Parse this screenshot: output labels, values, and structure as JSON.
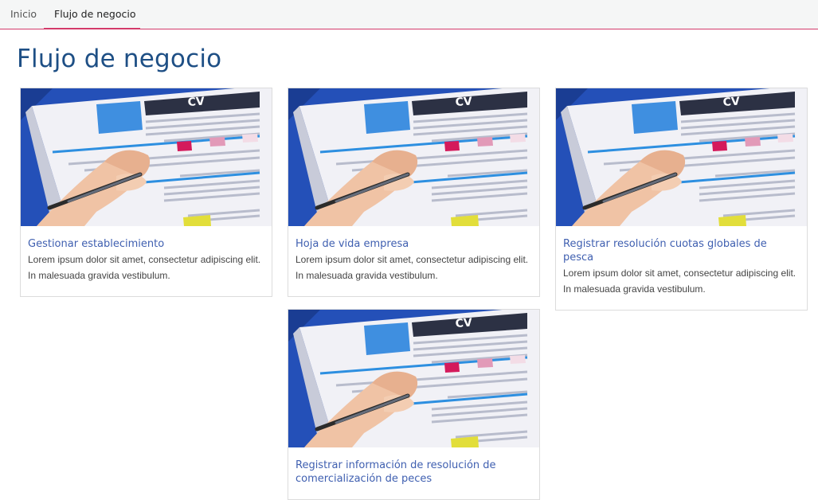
{
  "nav": {
    "tabs": [
      {
        "label": "Inicio"
      },
      {
        "label": "Flujo de negocio"
      }
    ]
  },
  "page": {
    "title": "Flujo de negocio"
  },
  "cards": [
    {
      "title": "Gestionar establecimiento",
      "description": "Lorem ipsum dolor sit amet, consectetur adipiscing elit. In malesuada gravida vestibulum.",
      "image": "cv-form-with-pen"
    },
    {
      "title": "Hoja de vida empresa",
      "description": "Lorem ipsum dolor sit amet, consectetur adipiscing elit. In malesuada gravida vestibulum.",
      "image": "cv-form-with-pen"
    },
    {
      "title": "Registrar resolución cuotas globales de pesca",
      "description": "Lorem ipsum dolor sit amet, consectetur adipiscing elit. In malesuada gravida vestibulum.",
      "image": "cv-form-with-pen"
    },
    {
      "title": "Registrar información de resolución de comercialización de peces",
      "description": "",
      "image": "cv-form-with-pen"
    }
  ],
  "image_text": "CV",
  "colors": {
    "accent": "#d33a6a",
    "title": "#1e4f85",
    "link": "#3f5fb0",
    "image_bg": "#2450b8"
  }
}
